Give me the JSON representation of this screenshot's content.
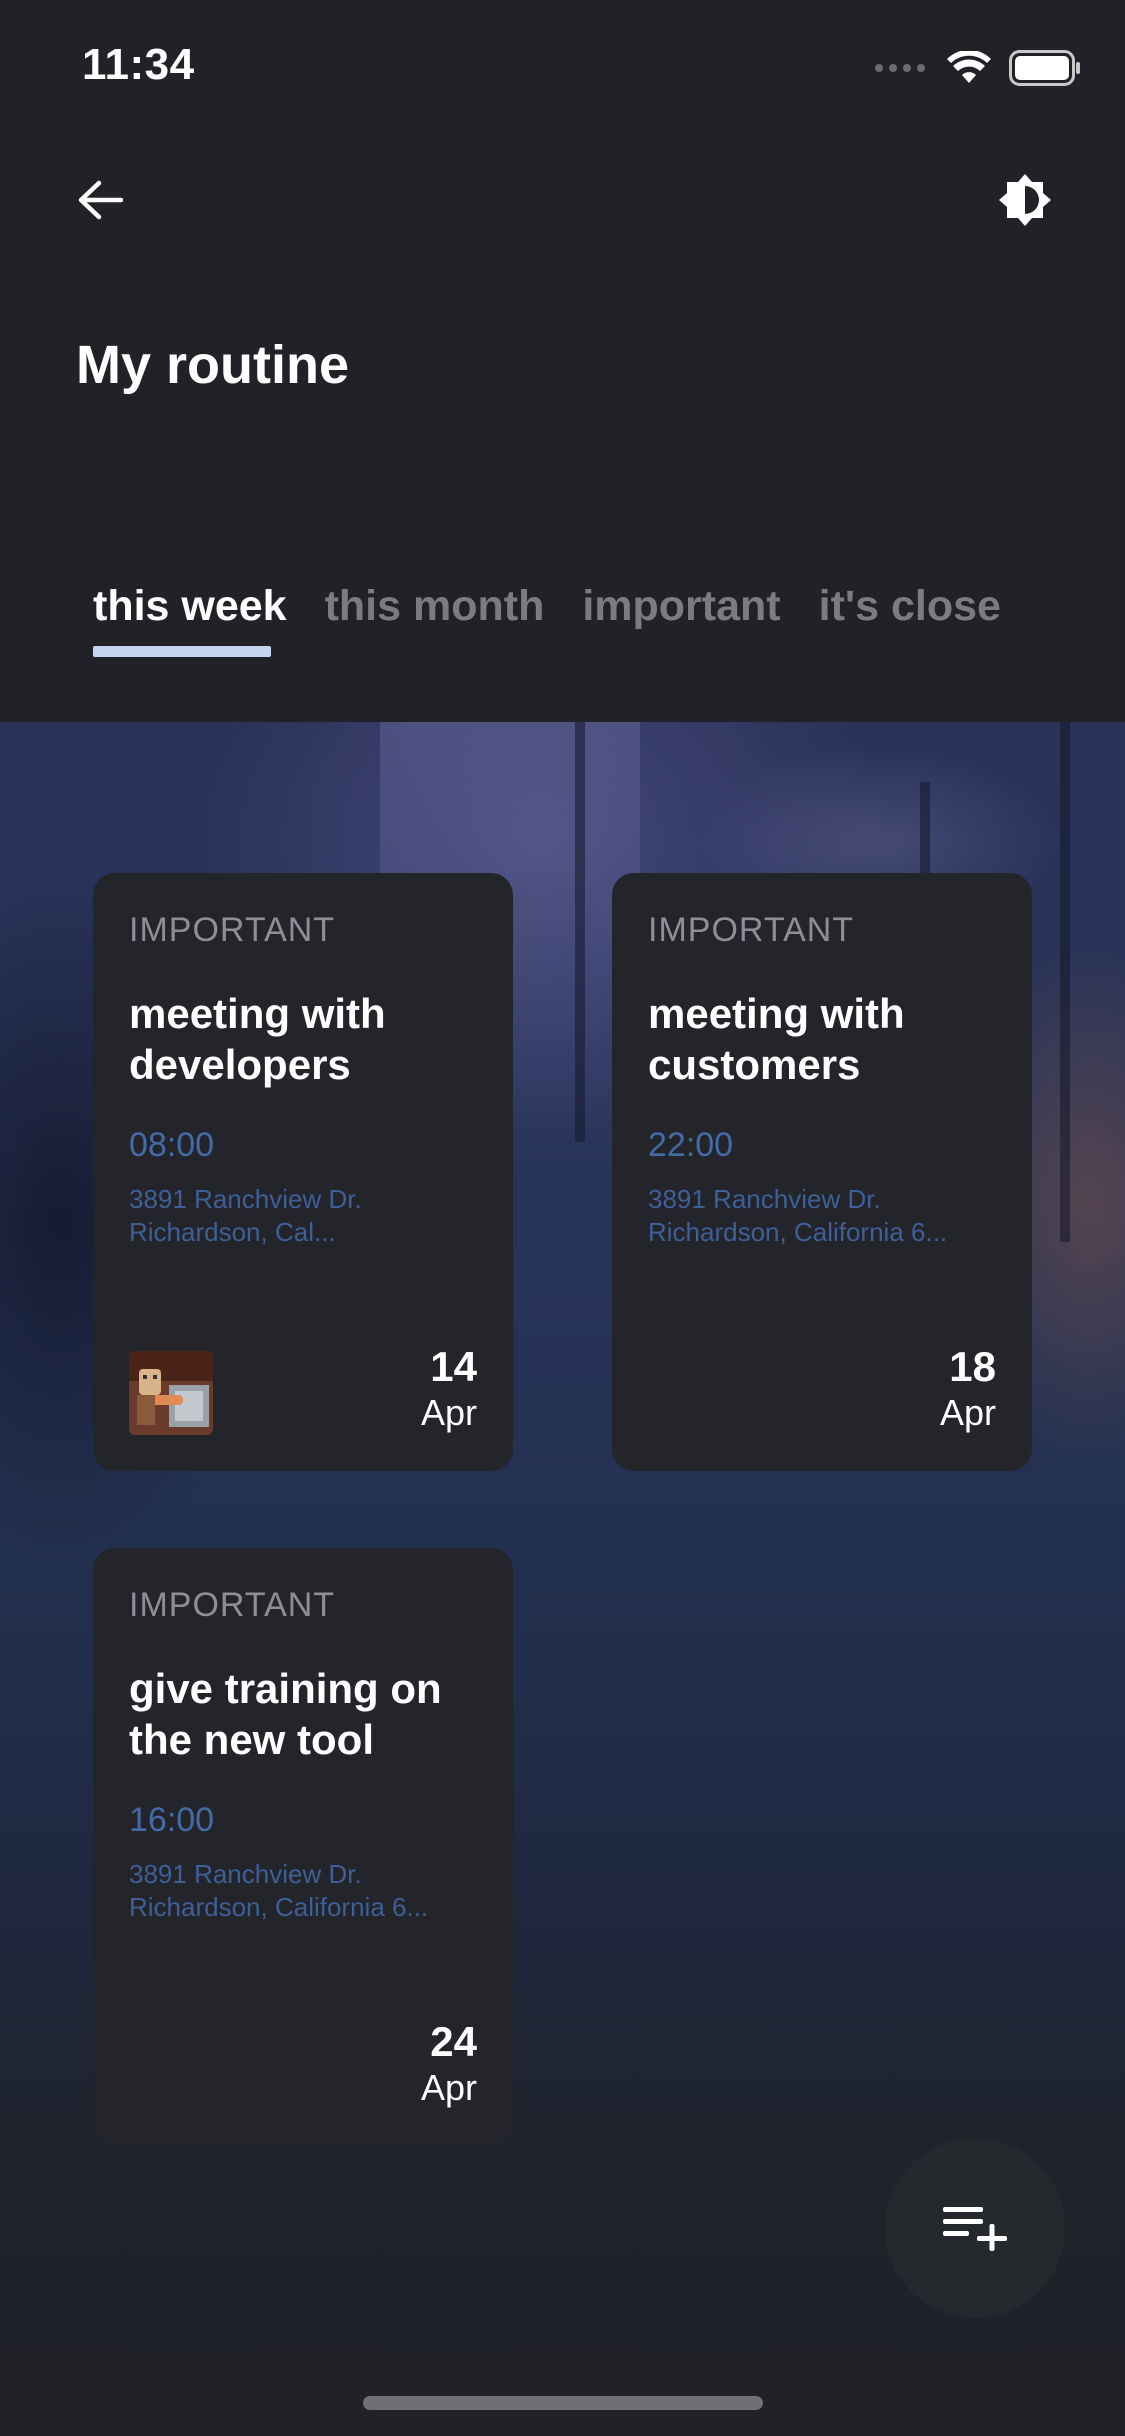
{
  "status_bar": {
    "time": "11:34"
  },
  "header": {
    "back_icon": "arrow-left-icon",
    "theme_icon": "brightness-contrast-icon",
    "title": "My routine"
  },
  "tabs": [
    {
      "label": "this week",
      "active": true
    },
    {
      "label": "this month",
      "active": false
    },
    {
      "label": "important",
      "active": false
    },
    {
      "label": "it's close",
      "active": false
    }
  ],
  "cards": [
    {
      "tag": "IMPORTANT",
      "title": "meeting with developers",
      "time": "08:00",
      "address": "3891 Ranchview Dr.\nRichardson, Cal...",
      "day": "14",
      "month": "Apr",
      "has_avatar": true
    },
    {
      "tag": "IMPORTANT",
      "title": "meeting with customers",
      "time": "22:00",
      "address": "3891 Ranchview Dr.\nRichardson, California 6...",
      "day": "18",
      "month": "Apr",
      "has_avatar": false
    },
    {
      "tag": "IMPORTANT",
      "title": "give training on the new tool",
      "time": "16:00",
      "address": "3891 Ranchview Dr.\nRichardson, California 6...",
      "day": "24",
      "month": "Apr",
      "has_avatar": false
    }
  ],
  "fab": {
    "icon": "playlist-add-icon"
  },
  "colors": {
    "background": "#202227",
    "card": "#23252b",
    "accent_blue": "#456aa8",
    "tab_indicator": "#c5d6f0",
    "tab_inactive": "#7a7c81"
  }
}
